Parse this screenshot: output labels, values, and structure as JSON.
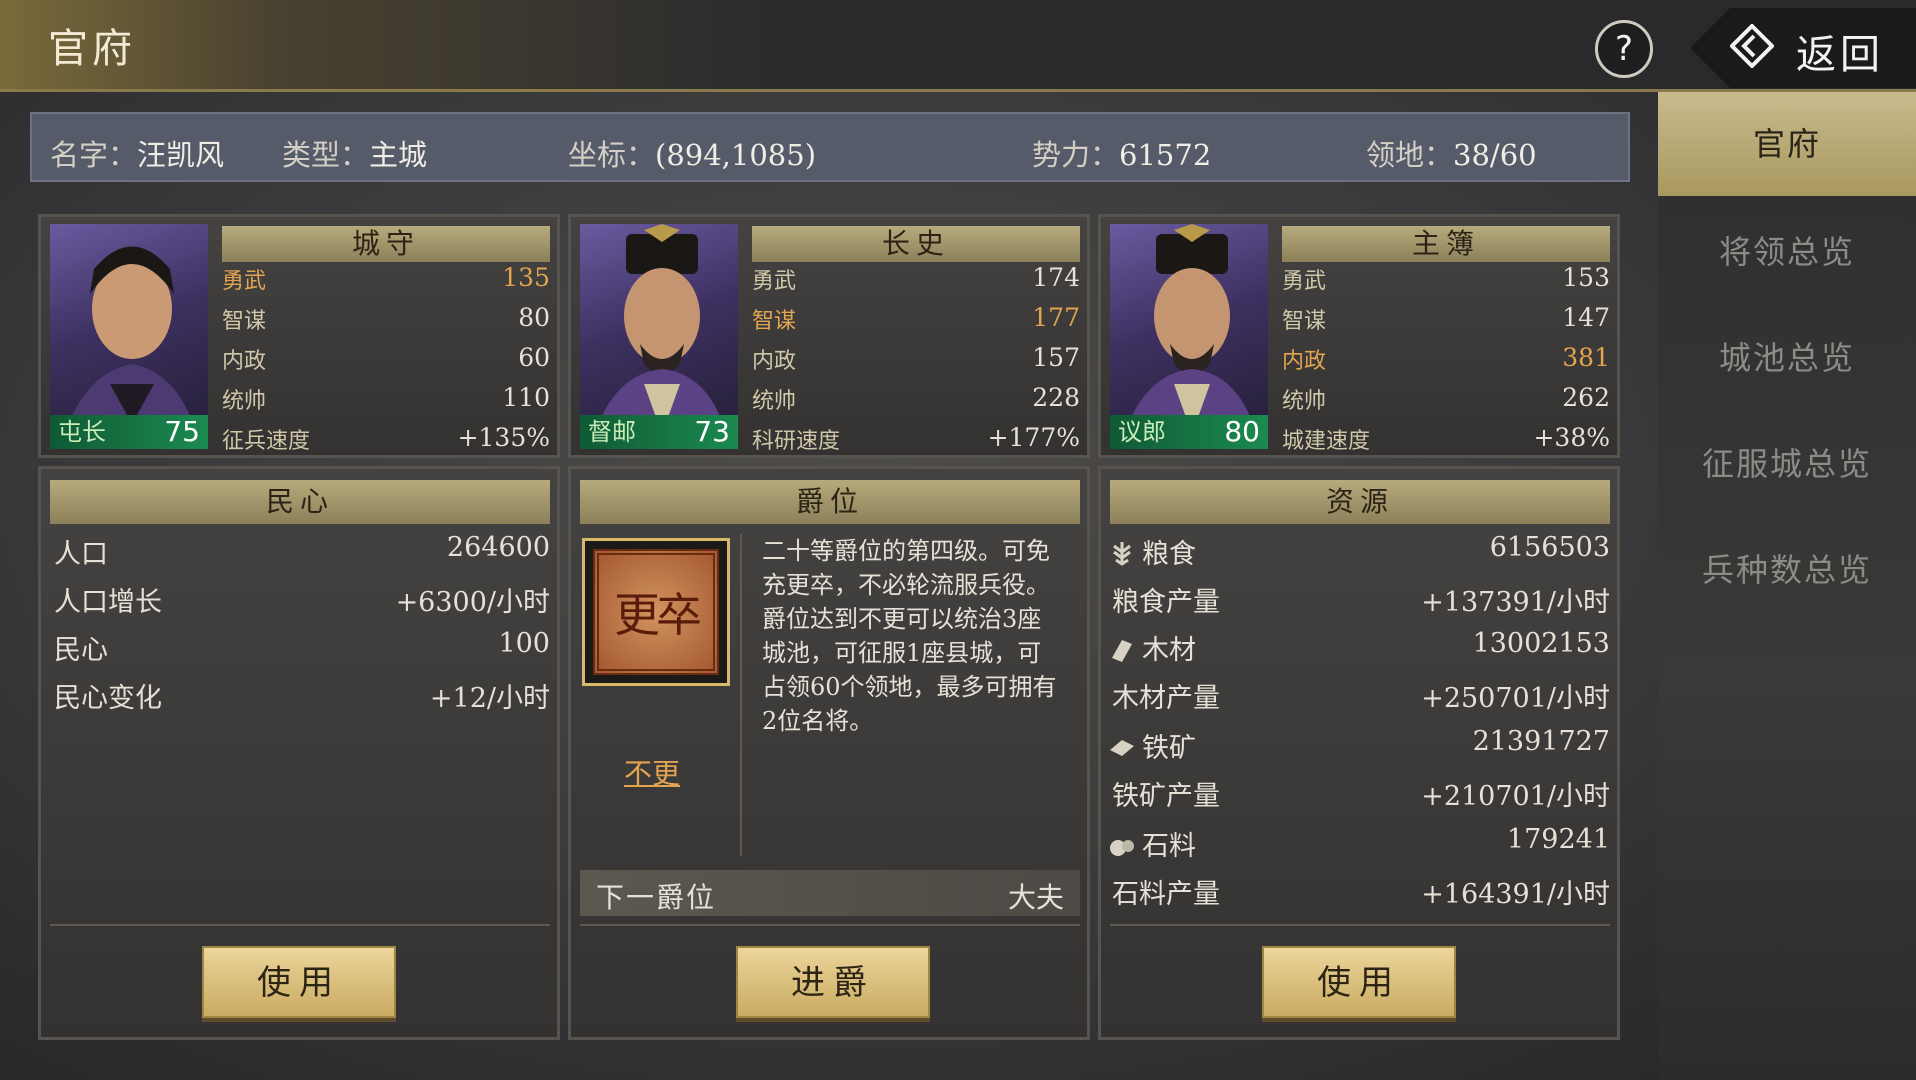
{
  "header": {
    "title": "官府",
    "help": "?",
    "back_label": "返回"
  },
  "info": {
    "name_label": "名字：",
    "name": "汪凯风",
    "type_label": "类型：",
    "type": "主城",
    "coord_label": "坐标：",
    "coord": "(894,1085)",
    "power_label": "势力：",
    "power": "61572",
    "territory_label": "领地：",
    "territory": "38/60"
  },
  "sidebar": {
    "items": [
      {
        "label": "官府",
        "active": true
      },
      {
        "label": "将领总览"
      },
      {
        "label": "城池总览"
      },
      {
        "label": "征服城总览"
      },
      {
        "label": "兵种数总览"
      }
    ]
  },
  "officials": [
    {
      "title": "城守",
      "rank": "屯长",
      "level": "75",
      "stats": [
        {
          "k": "勇武",
          "v": "135",
          "hi": true
        },
        {
          "k": "智谋",
          "v": "80"
        },
        {
          "k": "内政",
          "v": "60"
        },
        {
          "k": "统帅",
          "v": "110"
        },
        {
          "k": "征兵速度",
          "v": "+135%"
        }
      ]
    },
    {
      "title": "长史",
      "rank": "督邮",
      "level": "73",
      "stats": [
        {
          "k": "勇武",
          "v": "174"
        },
        {
          "k": "智谋",
          "v": "177",
          "hi": true
        },
        {
          "k": "内政",
          "v": "157"
        },
        {
          "k": "统帅",
          "v": "228"
        },
        {
          "k": "科研速度",
          "v": "+177%"
        }
      ]
    },
    {
      "title": "主簿",
      "rank": "议郎",
      "level": "80",
      "stats": [
        {
          "k": "勇武",
          "v": "153"
        },
        {
          "k": "智谋",
          "v": "147"
        },
        {
          "k": "内政",
          "v": "381",
          "hi": true
        },
        {
          "k": "统帅",
          "v": "262"
        },
        {
          "k": "城建速度",
          "v": "+38%"
        }
      ]
    }
  ],
  "minxin": {
    "title": "民心",
    "rows": [
      {
        "k": "人口",
        "v": "264600"
      },
      {
        "k": "人口增长",
        "v": "+6300/小时"
      },
      {
        "k": "民心",
        "v": "100"
      },
      {
        "k": "民心变化",
        "v": "+12/小时"
      }
    ],
    "button": "使用"
  },
  "jue": {
    "title": "爵位",
    "seal_text": "更卒",
    "current": "不更",
    "desc": "二十等爵位的第四级。可免充更卒，不必轮流服兵役。爵位达到不更可以统治3座城池，可征服1座县城，可占领60个领地，最多可拥有2位名将。",
    "next_label": "下一爵位",
    "next": "大夫",
    "button": "进爵"
  },
  "resources": {
    "title": "资源",
    "rows": [
      {
        "k": "粮食",
        "v": "6156503",
        "icon": "grain-icon"
      },
      {
        "k": "粮食产量",
        "v": "+137391/小时"
      },
      {
        "k": "木材",
        "v": "13002153",
        "icon": "wood-icon"
      },
      {
        "k": "木材产量",
        "v": "+250701/小时"
      },
      {
        "k": "铁矿",
        "v": "21391727",
        "icon": "iron-icon"
      },
      {
        "k": "铁矿产量",
        "v": "+210701/小时"
      },
      {
        "k": "石料",
        "v": "179241",
        "icon": "stone-icon"
      },
      {
        "k": "石料产量",
        "v": "+164391/小时"
      }
    ],
    "button": "使用"
  },
  "colors": {
    "accent_gold": "#c9ab62",
    "highlight": "#e3a451",
    "badge_green": "#1c8a50"
  }
}
